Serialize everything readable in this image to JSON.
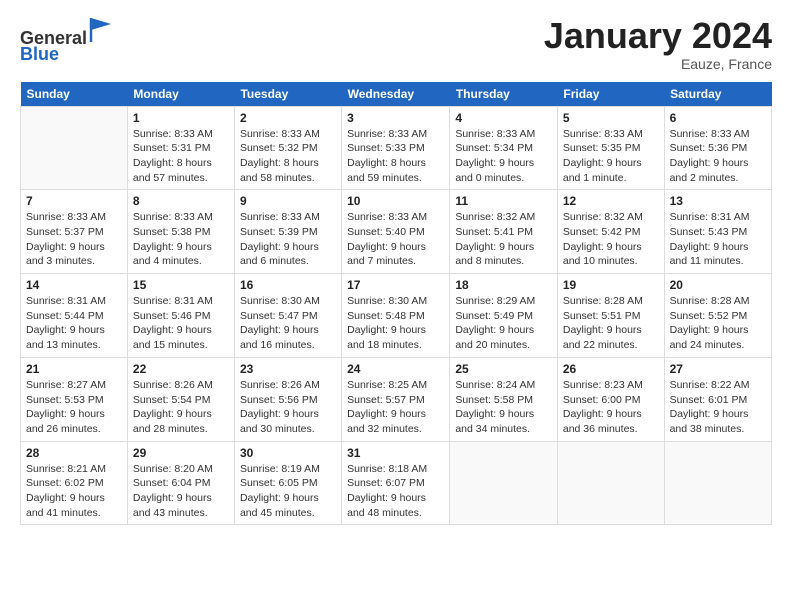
{
  "header": {
    "logo_line1": "General",
    "logo_line2": "Blue",
    "month_title": "January 2024",
    "location": "Eauze, France"
  },
  "weekdays": [
    "Sunday",
    "Monday",
    "Tuesday",
    "Wednesday",
    "Thursday",
    "Friday",
    "Saturday"
  ],
  "weeks": [
    [
      {
        "day": "",
        "info": ""
      },
      {
        "day": "1",
        "info": "Sunrise: 8:33 AM\nSunset: 5:31 PM\nDaylight: 8 hours\nand 57 minutes."
      },
      {
        "day": "2",
        "info": "Sunrise: 8:33 AM\nSunset: 5:32 PM\nDaylight: 8 hours\nand 58 minutes."
      },
      {
        "day": "3",
        "info": "Sunrise: 8:33 AM\nSunset: 5:33 PM\nDaylight: 8 hours\nand 59 minutes."
      },
      {
        "day": "4",
        "info": "Sunrise: 8:33 AM\nSunset: 5:34 PM\nDaylight: 9 hours\nand 0 minutes."
      },
      {
        "day": "5",
        "info": "Sunrise: 8:33 AM\nSunset: 5:35 PM\nDaylight: 9 hours\nand 1 minute."
      },
      {
        "day": "6",
        "info": "Sunrise: 8:33 AM\nSunset: 5:36 PM\nDaylight: 9 hours\nand 2 minutes."
      }
    ],
    [
      {
        "day": "7",
        "info": "Sunrise: 8:33 AM\nSunset: 5:37 PM\nDaylight: 9 hours\nand 3 minutes."
      },
      {
        "day": "8",
        "info": "Sunrise: 8:33 AM\nSunset: 5:38 PM\nDaylight: 9 hours\nand 4 minutes."
      },
      {
        "day": "9",
        "info": "Sunrise: 8:33 AM\nSunset: 5:39 PM\nDaylight: 9 hours\nand 6 minutes."
      },
      {
        "day": "10",
        "info": "Sunrise: 8:33 AM\nSunset: 5:40 PM\nDaylight: 9 hours\nand 7 minutes."
      },
      {
        "day": "11",
        "info": "Sunrise: 8:32 AM\nSunset: 5:41 PM\nDaylight: 9 hours\nand 8 minutes."
      },
      {
        "day": "12",
        "info": "Sunrise: 8:32 AM\nSunset: 5:42 PM\nDaylight: 9 hours\nand 10 minutes."
      },
      {
        "day": "13",
        "info": "Sunrise: 8:31 AM\nSunset: 5:43 PM\nDaylight: 9 hours\nand 11 minutes."
      }
    ],
    [
      {
        "day": "14",
        "info": "Sunrise: 8:31 AM\nSunset: 5:44 PM\nDaylight: 9 hours\nand 13 minutes."
      },
      {
        "day": "15",
        "info": "Sunrise: 8:31 AM\nSunset: 5:46 PM\nDaylight: 9 hours\nand 15 minutes."
      },
      {
        "day": "16",
        "info": "Sunrise: 8:30 AM\nSunset: 5:47 PM\nDaylight: 9 hours\nand 16 minutes."
      },
      {
        "day": "17",
        "info": "Sunrise: 8:30 AM\nSunset: 5:48 PM\nDaylight: 9 hours\nand 18 minutes."
      },
      {
        "day": "18",
        "info": "Sunrise: 8:29 AM\nSunset: 5:49 PM\nDaylight: 9 hours\nand 20 minutes."
      },
      {
        "day": "19",
        "info": "Sunrise: 8:28 AM\nSunset: 5:51 PM\nDaylight: 9 hours\nand 22 minutes."
      },
      {
        "day": "20",
        "info": "Sunrise: 8:28 AM\nSunset: 5:52 PM\nDaylight: 9 hours\nand 24 minutes."
      }
    ],
    [
      {
        "day": "21",
        "info": "Sunrise: 8:27 AM\nSunset: 5:53 PM\nDaylight: 9 hours\nand 26 minutes."
      },
      {
        "day": "22",
        "info": "Sunrise: 8:26 AM\nSunset: 5:54 PM\nDaylight: 9 hours\nand 28 minutes."
      },
      {
        "day": "23",
        "info": "Sunrise: 8:26 AM\nSunset: 5:56 PM\nDaylight: 9 hours\nand 30 minutes."
      },
      {
        "day": "24",
        "info": "Sunrise: 8:25 AM\nSunset: 5:57 PM\nDaylight: 9 hours\nand 32 minutes."
      },
      {
        "day": "25",
        "info": "Sunrise: 8:24 AM\nSunset: 5:58 PM\nDaylight: 9 hours\nand 34 minutes."
      },
      {
        "day": "26",
        "info": "Sunrise: 8:23 AM\nSunset: 6:00 PM\nDaylight: 9 hours\nand 36 minutes."
      },
      {
        "day": "27",
        "info": "Sunrise: 8:22 AM\nSunset: 6:01 PM\nDaylight: 9 hours\nand 38 minutes."
      }
    ],
    [
      {
        "day": "28",
        "info": "Sunrise: 8:21 AM\nSunset: 6:02 PM\nDaylight: 9 hours\nand 41 minutes."
      },
      {
        "day": "29",
        "info": "Sunrise: 8:20 AM\nSunset: 6:04 PM\nDaylight: 9 hours\nand 43 minutes."
      },
      {
        "day": "30",
        "info": "Sunrise: 8:19 AM\nSunset: 6:05 PM\nDaylight: 9 hours\nand 45 minutes."
      },
      {
        "day": "31",
        "info": "Sunrise: 8:18 AM\nSunset: 6:07 PM\nDaylight: 9 hours\nand 48 minutes."
      },
      {
        "day": "",
        "info": ""
      },
      {
        "day": "",
        "info": ""
      },
      {
        "day": "",
        "info": ""
      }
    ]
  ]
}
